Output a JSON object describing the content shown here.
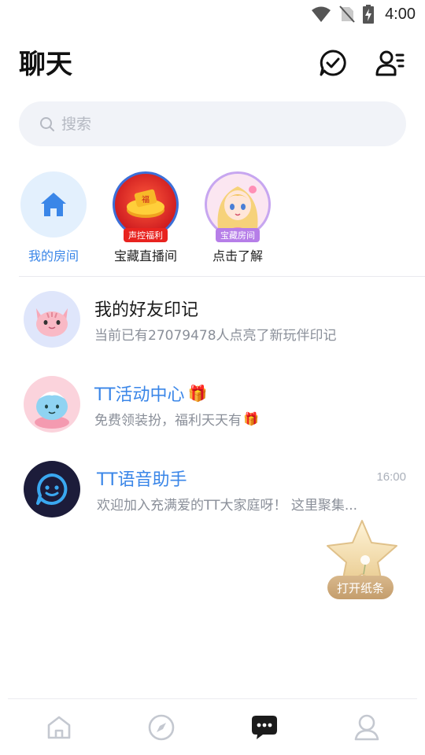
{
  "status_bar": {
    "time": "4:00",
    "icons": [
      "wifi-icon",
      "no-sim-icon",
      "battery-charging-icon"
    ]
  },
  "header": {
    "title": "聊天",
    "actions": [
      "message-check-icon",
      "contacts-icon"
    ]
  },
  "search": {
    "placeholder": "搜索",
    "icon": "search-icon"
  },
  "quick_entries": [
    {
      "label": "我的房间",
      "icon": "home-icon",
      "active": true
    },
    {
      "label": "宝藏直播间",
      "badge": "声控福利",
      "icon": "live-room-icon"
    },
    {
      "label": "点击了解",
      "badge": "宝藏房间",
      "icon": "anime-girl-avatar"
    }
  ],
  "conversations": [
    {
      "title": "我的好友印记",
      "subtitle": "当前已有27079478人点亮了新玩伴印记",
      "avatar": "cat-avatar"
    },
    {
      "title": "TT活动中心",
      "title_emoji": "🎁",
      "subtitle": "免费领装扮，福利天天有",
      "subtitle_emoji": "🎁",
      "avatar": "mascot-avatar"
    },
    {
      "title": "TT语音助手",
      "subtitle": "欢迎加入充满爱的TT大家庭呀！ 这里聚集...",
      "time": "16:00",
      "avatar": "assistant-avatar"
    }
  ],
  "floating": {
    "label": "打开纸条",
    "icon": "star-icon"
  },
  "bottom_nav": [
    {
      "name": "home",
      "icon": "home-outline-icon",
      "active": false
    },
    {
      "name": "discover",
      "icon": "compass-icon",
      "active": false
    },
    {
      "name": "chat",
      "icon": "chat-bubble-icon",
      "active": true
    },
    {
      "name": "profile",
      "icon": "user-icon",
      "active": false
    }
  ],
  "colors": {
    "accent": "#3a86e8",
    "search_bg": "#f1f3f8",
    "subtitle": "#8a8f99"
  }
}
